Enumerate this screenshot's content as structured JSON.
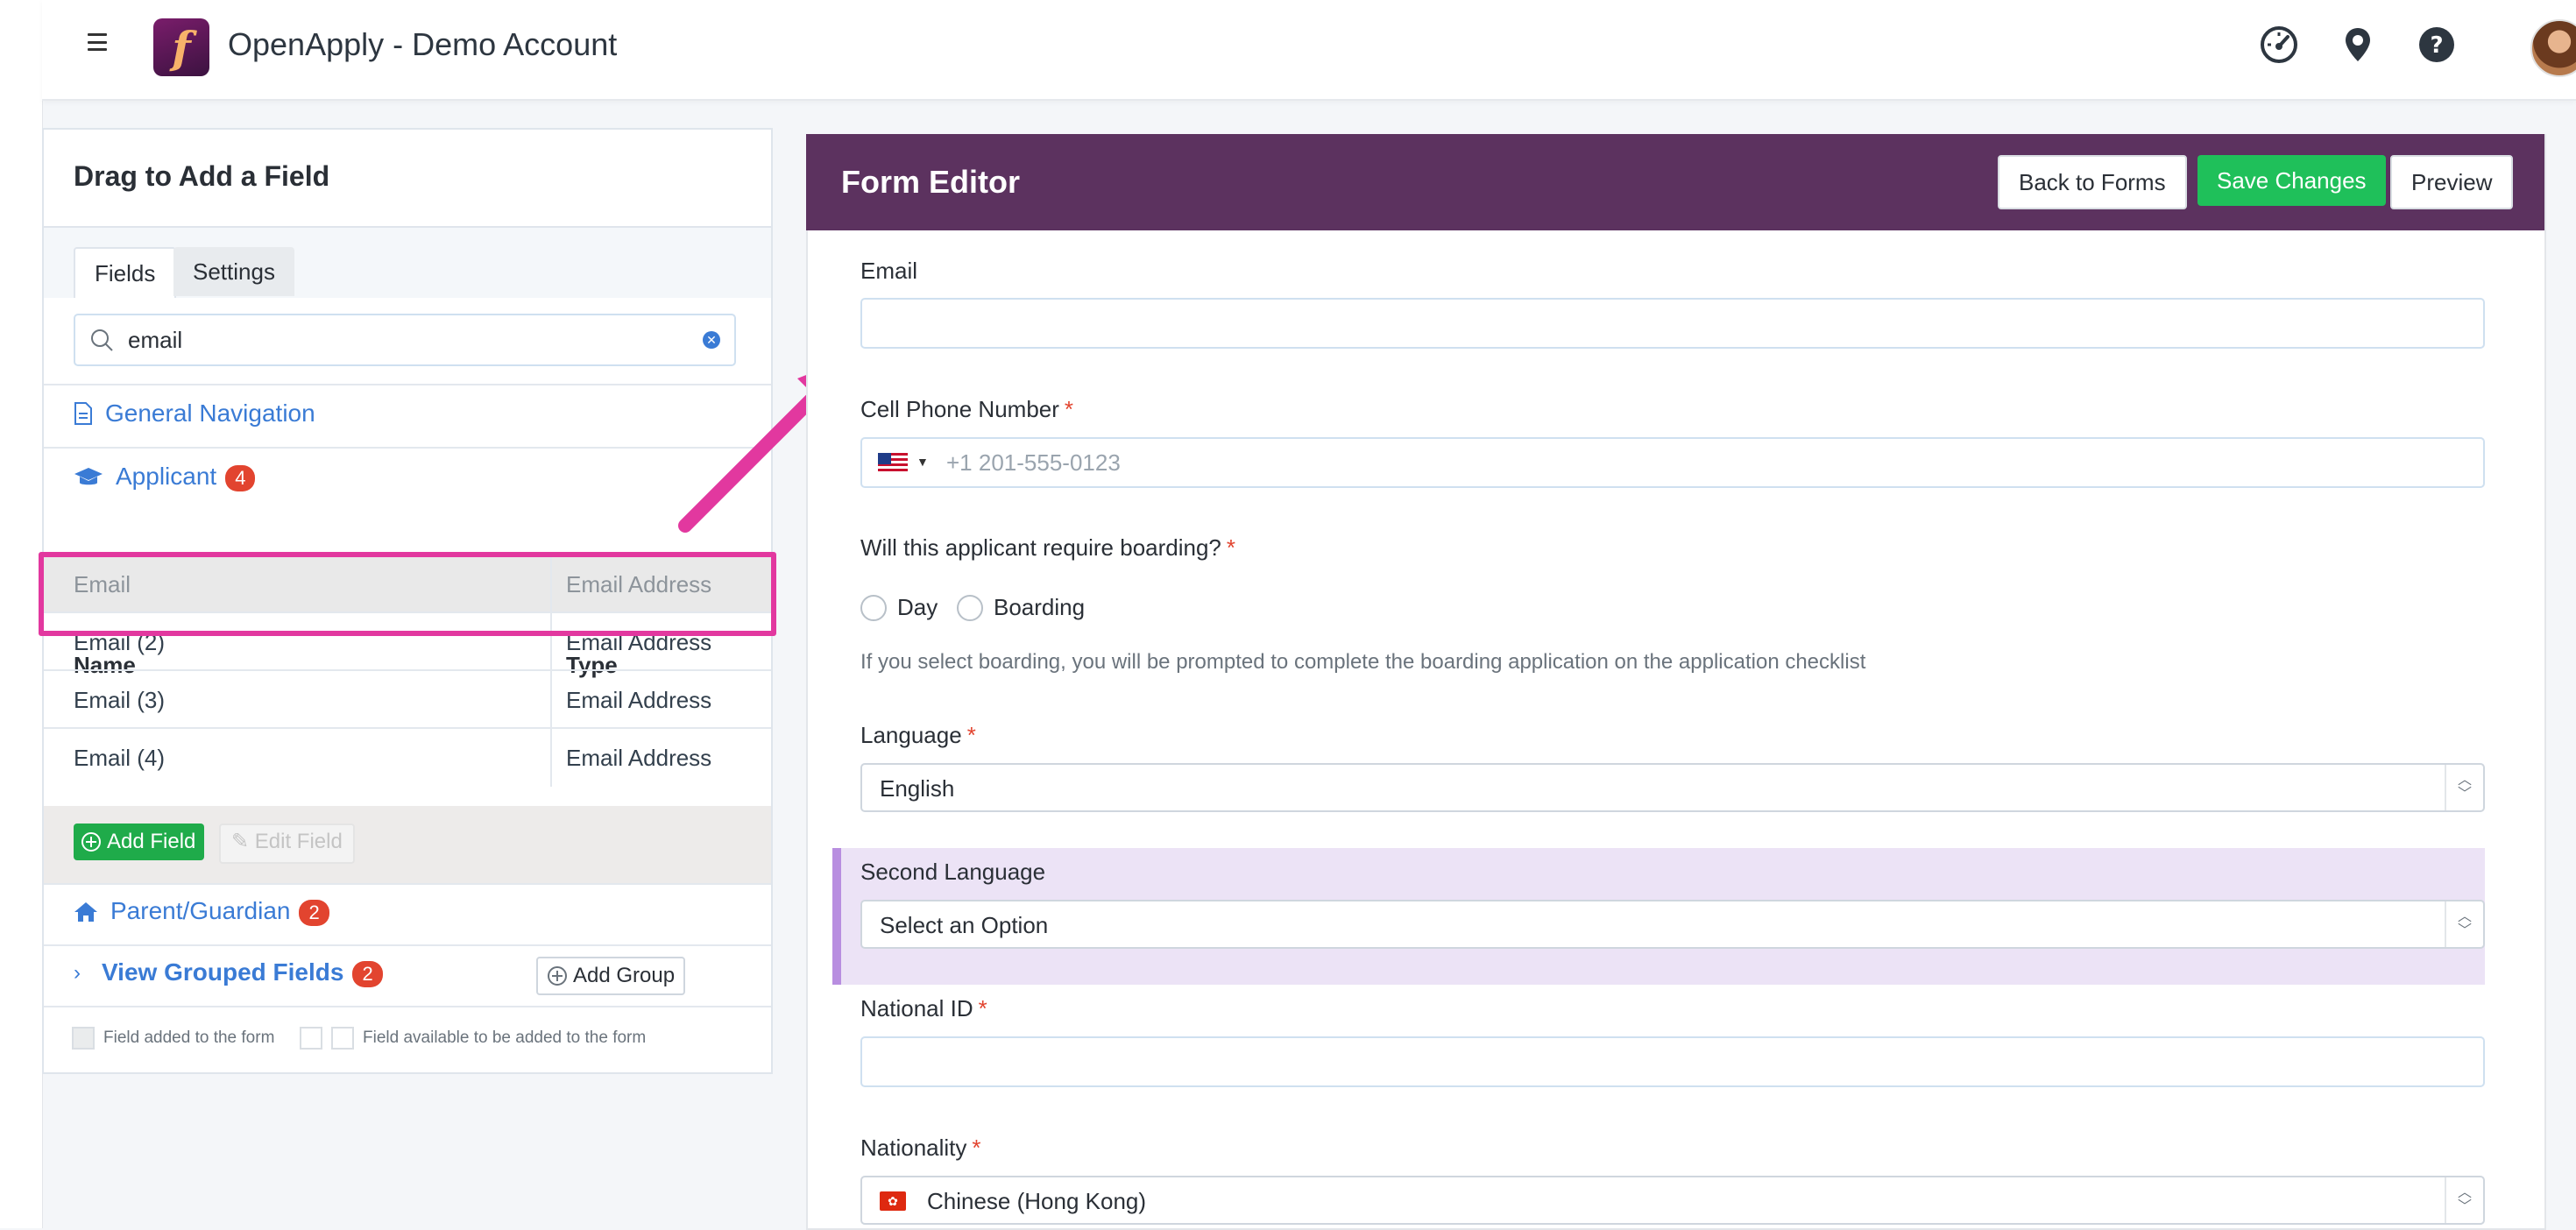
{
  "app": {
    "title": "OpenApply - Demo Account"
  },
  "topbar_icons": [
    "dashboard-gauge-icon",
    "location-pin-icon",
    "help-icon",
    "user-avatar"
  ],
  "left_panel": {
    "title": "Drag to Add a Field",
    "tabs": [
      {
        "label": "Fields",
        "active": true
      },
      {
        "label": "Settings",
        "active": false
      }
    ],
    "search": {
      "value": "email"
    },
    "sections": {
      "general_navigation": "General Navigation",
      "applicant": {
        "label": "Applicant",
        "count": "4"
      },
      "parent_guardian": {
        "label": "Parent/Guardian",
        "count": "2"
      },
      "grouped": {
        "label": "View Grouped Fields",
        "count": "2"
      }
    },
    "table": {
      "headers": {
        "name": "Name",
        "type": "Type"
      },
      "rows": [
        {
          "name": "Email",
          "type": "Email Address",
          "added": true
        },
        {
          "name": "Email (2)",
          "type": "Email Address",
          "added": false
        },
        {
          "name": "Email (3)",
          "type": "Email Address",
          "added": false
        },
        {
          "name": "Email (4)",
          "type": "Email Address",
          "added": false
        }
      ]
    },
    "buttons": {
      "add_field": "Add Field",
      "edit_field": "Edit Field",
      "add_group": "Add Group"
    },
    "legend": {
      "added": "Field added to the form",
      "available": "Field available to be added to the form"
    }
  },
  "editor": {
    "title": "Form Editor",
    "buttons": {
      "back": "Back to Forms",
      "save": "Save Changes",
      "preview": "Preview"
    },
    "fields": {
      "email": {
        "label": "Email",
        "value": ""
      },
      "phone": {
        "label": "Cell Phone Number",
        "required": "*",
        "placeholder": "+1 201-555-0123"
      },
      "boarding": {
        "label": "Will this applicant require boarding?",
        "required": "*",
        "options": [
          "Day",
          "Boarding"
        ],
        "help": "If you select boarding, you will be prompted to complete the boarding application on the application checklist"
      },
      "language": {
        "label": "Language",
        "required": "*",
        "value": "English"
      },
      "second_language": {
        "label": "Second Language",
        "value": "Select an Option"
      },
      "national_id": {
        "label": "National ID",
        "required": "*",
        "value": ""
      },
      "nationality": {
        "label": "Nationality",
        "required": "*",
        "value": "Chinese (Hong Kong)"
      }
    }
  },
  "colors": {
    "editor_header": "#5c325f",
    "save_button": "#1fc05a",
    "add_button": "#1fab4a",
    "link": "#3a7bd5",
    "badge": "#e2442f",
    "highlight": "#e2389f",
    "second_language_bg": "#ece3f6"
  }
}
